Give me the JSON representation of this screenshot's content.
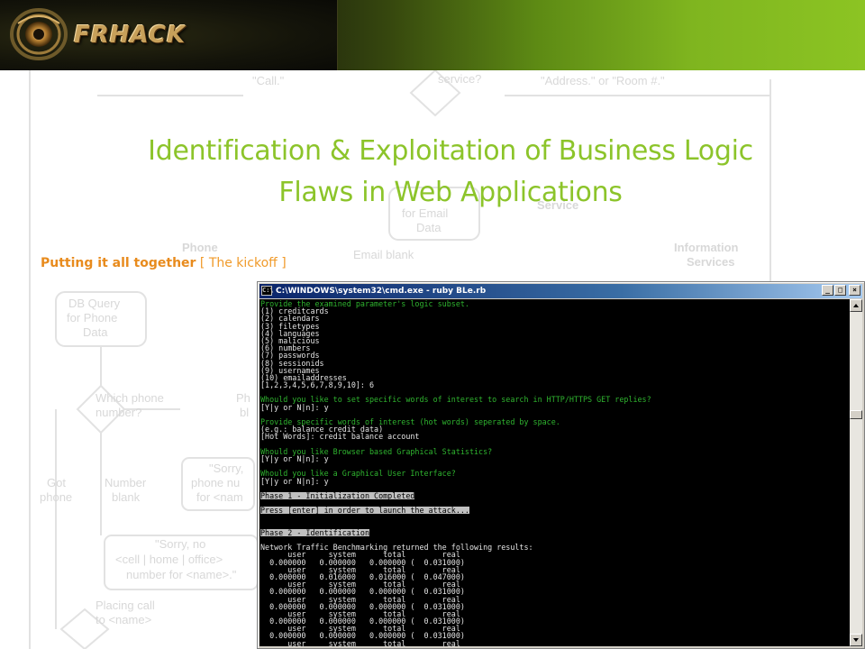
{
  "banner": {
    "logo_text": "FRHACK",
    "colors": {
      "dark": "#0b0d05",
      "green": "#8cc423"
    }
  },
  "background_flowchart": {
    "labels": [
      "\"Call.\"",
      "service?",
      "\"Address.\" or \"Room #.\"",
      "for Email",
      "Data",
      "Service",
      "Phone",
      "Email blank",
      "Information",
      "Services",
      "DB Query",
      "for Phone",
      "Data",
      "Which phone",
      "number?",
      "Ph",
      "bl",
      "Got",
      "phone",
      "Number",
      "blank",
      "\"Sorry,",
      "phone nu",
      "for <nam",
      "\"Sorry, no",
      "<cell | home | office>",
      "number for <name>.\"",
      "Placing call",
      "to <name>"
    ]
  },
  "slide": {
    "title_line1": "Identification & Exploitation of Business Logic",
    "title_line2": "Flaws in Web Applications",
    "subtitle_strong": "Putting it all together",
    "subtitle_light": " [ The kickoff ]",
    "title_color": "#8cc42a",
    "subtitle_color": "#e88b1d"
  },
  "cmd": {
    "window_title": "C:\\WINDOWS\\system32\\cmd.exe - ruby BLe.rb",
    "icon_label": "C:\\",
    "buttons": {
      "minimize": "_",
      "maximize": "□",
      "close": "×"
    },
    "lines": [
      {
        "text": "Provide the examined parameter's logic subset.",
        "style": "green"
      },
      {
        "text": "(1) creditcards",
        "style": "white"
      },
      {
        "text": "(2) calendars",
        "style": "white"
      },
      {
        "text": "(3) filetypes",
        "style": "white"
      },
      {
        "text": "(4) languages",
        "style": "white"
      },
      {
        "text": "(5) malicious",
        "style": "white"
      },
      {
        "text": "(6) numbers",
        "style": "white"
      },
      {
        "text": "(7) passwords",
        "style": "white"
      },
      {
        "text": "(8) sessionids",
        "style": "white"
      },
      {
        "text": "(9) usernames",
        "style": "white"
      },
      {
        "text": "(10) emailaddresses",
        "style": "white"
      },
      {
        "text": "[1,2,3,4,5,6,7,8,9,10]: 6",
        "style": "white"
      },
      {
        "text": "",
        "style": "blank"
      },
      {
        "text": "Whould you like to set specific words of interest to search in HTTP/HTTPS GET replies?",
        "style": "green"
      },
      {
        "text": "[Y|y or N|n]: y",
        "style": "white"
      },
      {
        "text": "",
        "style": "blank"
      },
      {
        "text": "Provide specific words of interest (hot words) seperated by space.",
        "style": "green"
      },
      {
        "text": "(e.g.: balance credit data)",
        "style": "white"
      },
      {
        "text": "[Hot Words]: credit balance account",
        "style": "white"
      },
      {
        "text": "",
        "style": "blank"
      },
      {
        "text": "Whould you like Browser based Graphical Statistics?",
        "style": "green"
      },
      {
        "text": "[Y|y or N|n]: y",
        "style": "white"
      },
      {
        "text": "",
        "style": "blank"
      },
      {
        "text": "Whould you like a Graphical User Interface?",
        "style": "green"
      },
      {
        "text": "[Y|y or N|n]: y",
        "style": "white"
      },
      {
        "text": "",
        "style": "blank"
      },
      {
        "text": "Phase 1 - Initialization Completed",
        "style": "hl"
      },
      {
        "text": "",
        "style": "blank"
      },
      {
        "text": "Press [enter] in order to launch the attack...",
        "style": "hl"
      },
      {
        "text": "",
        "style": "blank"
      },
      {
        "text": "",
        "style": "blank"
      },
      {
        "text": "Phase 2 - Identification",
        "style": "hl"
      },
      {
        "text": "",
        "style": "blank"
      },
      {
        "text": "Network Traffic Benchmarking returned the following results:",
        "style": "white"
      },
      {
        "text": "      user     system      total        real",
        "style": "white"
      },
      {
        "text": "  0.000000   0.000000   0.000000 (  0.031000)",
        "style": "white"
      },
      {
        "text": "      user     system      total        real",
        "style": "white"
      },
      {
        "text": "  0.000000   0.016000   0.016000 (  0.047000)",
        "style": "white"
      },
      {
        "text": "      user     system      total        real",
        "style": "white"
      },
      {
        "text": "  0.000000   0.000000   0.000000 (  0.031000)",
        "style": "white"
      },
      {
        "text": "      user     system      total        real",
        "style": "white"
      },
      {
        "text": "  0.000000   0.000000   0.000000 (  0.031000)",
        "style": "white"
      },
      {
        "text": "      user     system      total        real",
        "style": "white"
      },
      {
        "text": "  0.000000   0.000000   0.000000 (  0.031000)",
        "style": "white"
      },
      {
        "text": "      user     system      total        real",
        "style": "white"
      },
      {
        "text": "  0.000000   0.000000   0.000000 (  0.031000)",
        "style": "white"
      },
      {
        "text": "      user     system      total        real",
        "style": "white"
      }
    ]
  }
}
